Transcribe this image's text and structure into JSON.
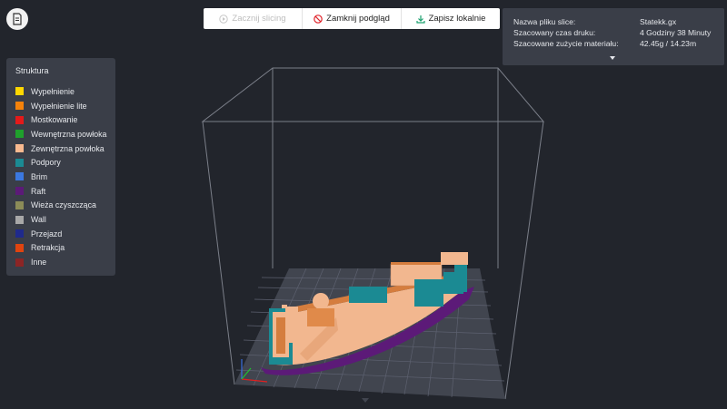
{
  "toolbar": {
    "start_slicing": "Zacznij slicing",
    "close_preview": "Zamknij podgląd",
    "save_locally": "Zapisz lokalnie"
  },
  "legend": {
    "title": "Struktura",
    "items": [
      {
        "label": "Wypełnienie",
        "color": "#ffd700"
      },
      {
        "label": "Wypełnienie lite",
        "color": "#f5820a"
      },
      {
        "label": "Mostkowanie",
        "color": "#e31a1a"
      },
      {
        "label": "Wewnętrzna powłoka",
        "color": "#1fa02c"
      },
      {
        "label": "Zewnętrzna powłoka",
        "color": "#f8b98f"
      },
      {
        "label": "Podpory",
        "color": "#1b8a93"
      },
      {
        "label": "Brim",
        "color": "#3b78e0"
      },
      {
        "label": "Raft",
        "color": "#5c1a78"
      },
      {
        "label": "Wieża czyszcząca",
        "color": "#8c8c58"
      },
      {
        "label": "Wall",
        "color": "#a8a8a8"
      },
      {
        "label": "Przejazd",
        "color": "#1f2a8c"
      },
      {
        "label": "Retrakcja",
        "color": "#e0440f"
      },
      {
        "label": "Inne",
        "color": "#8c2525"
      }
    ]
  },
  "info": {
    "rows": [
      {
        "label": "Nazwa pliku slice:",
        "value": "Statekk.gx"
      },
      {
        "label": "Szacowany czas druku:",
        "value": "4 Godziny 38 Minuty"
      },
      {
        "label": "Szacowane zużycie materiału:",
        "value": "42.45g / 14.23m"
      }
    ]
  },
  "icons": {
    "app": "document-icon",
    "start": "play-icon",
    "close": "no-entry-icon",
    "save": "download-icon",
    "expand": "chevron-down-icon"
  },
  "colors": {
    "background": "#22252c",
    "panel": "#3a3e48",
    "close_icon": "#e0252c",
    "save_icon": "#1aa06e",
    "hull": "#f2b78f",
    "raft": "#5c1a78",
    "supports": "#1b8a93"
  }
}
